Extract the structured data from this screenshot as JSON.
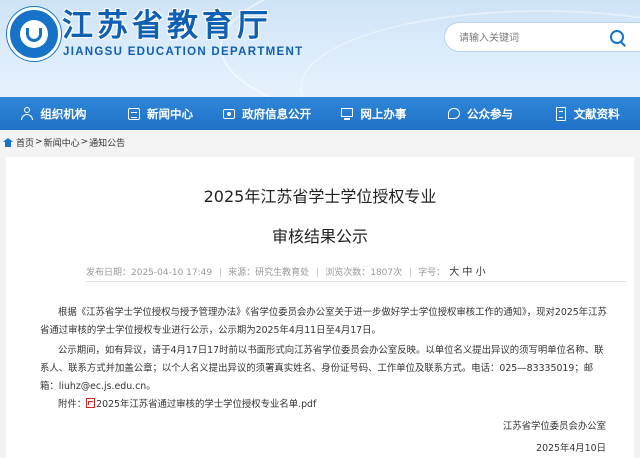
{
  "header": {
    "title": "江苏省教育厅",
    "subtitle": "JIANGSU EDUCATION DEPARTMENT",
    "search_placeholder": "请输入关键词"
  },
  "nav": [
    {
      "label": "组织机构",
      "icon": "org-icon"
    },
    {
      "label": "新闻中心",
      "icon": "news-icon"
    },
    {
      "label": "政府信息公开",
      "icon": "gov-info-icon"
    },
    {
      "label": "网上办事",
      "icon": "online-service-icon"
    },
    {
      "label": "公众参与",
      "icon": "public-icon"
    },
    {
      "label": "文献资料",
      "icon": "docs-icon"
    }
  ],
  "breadcrumb": {
    "home": "首页",
    "news": "新闻中心",
    "notice": "通知公告",
    "sep": ">"
  },
  "article": {
    "title_line1": "2025年江苏省学士学位授权专业",
    "title_line2": "审核结果公示",
    "meta": {
      "published": "发布日期：2025-04-10 17:49",
      "source": "来源：研究生教育处",
      "views": "浏览次数：1807次",
      "font_label": "字号：",
      "font_large": "大",
      "font_medium": "中",
      "font_small": "小"
    },
    "paragraph1": "根据《江苏省学士学位授权与授予管理办法》《省学位委员会办公室关于进一步做好学士学位授权审核工作的通知》，现对2025年江苏省通过审核的学士学位授权专业进行公示，公示期为2025年4月11日至4月17日。",
    "paragraph2": "公示期间，如有异议，请于4月17日17时前以书面形式向江苏省学位委员会办公室反映。以单位名义提出异议的须写明单位名称、联系人、联系方式并加盖公章；以个人名义提出异议的须署真实姓名、身份证号码、工作单位及联系方式。电话：025—83335019；邮箱：liuhz@ec.js.edu.cn。",
    "attachment_label": "附件：",
    "attachment_file": "2025年江苏省通过审核的学士学位授权专业名单.pdf",
    "signature_org": "江苏省学位委员会办公室",
    "signature_date": "2025年4月10日"
  },
  "colors": {
    "brand_blue": "#1673c9",
    "nav_blue": "#2a7fd3"
  }
}
